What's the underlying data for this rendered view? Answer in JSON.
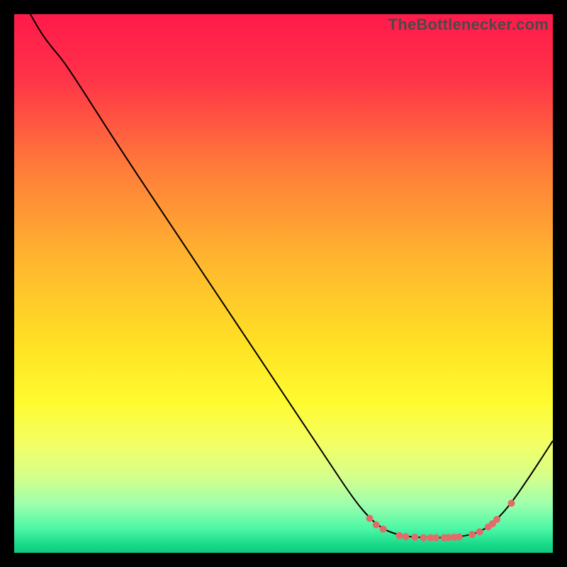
{
  "watermark": "TheBottlenecker.com",
  "chart_data": {
    "type": "line",
    "title": "",
    "xlabel": "",
    "ylabel": "",
    "xlim": [
      0,
      100
    ],
    "ylim": [
      0,
      100
    ],
    "grid": false,
    "background_gradient": {
      "stops": [
        {
          "offset": 0,
          "color": "#ff1a4b"
        },
        {
          "offset": 0.12,
          "color": "#ff3348"
        },
        {
          "offset": 0.28,
          "color": "#ff7a3a"
        },
        {
          "offset": 0.45,
          "color": "#ffb42f"
        },
        {
          "offset": 0.62,
          "color": "#ffe324"
        },
        {
          "offset": 0.72,
          "color": "#fffb30"
        },
        {
          "offset": 0.8,
          "color": "#f2ff66"
        },
        {
          "offset": 0.86,
          "color": "#d4ff8c"
        },
        {
          "offset": 0.91,
          "color": "#9dffad"
        },
        {
          "offset": 0.955,
          "color": "#4cf7a6"
        },
        {
          "offset": 0.985,
          "color": "#19d98a"
        },
        {
          "offset": 1.0,
          "color": "#10c97e"
        }
      ]
    },
    "series": [
      {
        "name": "bottleneck-curve",
        "color": "#000000",
        "stroke_width": 2,
        "points": [
          {
            "x": 3.0,
            "y": 100.0
          },
          {
            "x": 5.0,
            "y": 96.5
          },
          {
            "x": 7.0,
            "y": 93.8
          },
          {
            "x": 9.0,
            "y": 91.5
          },
          {
            "x": 12.0,
            "y": 87.0
          },
          {
            "x": 20.0,
            "y": 74.5
          },
          {
            "x": 30.0,
            "y": 59.5
          },
          {
            "x": 40.0,
            "y": 44.5
          },
          {
            "x": 50.0,
            "y": 29.5
          },
          {
            "x": 58.0,
            "y": 17.5
          },
          {
            "x": 63.0,
            "y": 10.0
          },
          {
            "x": 66.0,
            "y": 6.4
          },
          {
            "x": 68.5,
            "y": 4.4
          },
          {
            "x": 71.0,
            "y": 3.4
          },
          {
            "x": 74.0,
            "y": 2.9
          },
          {
            "x": 78.0,
            "y": 2.8
          },
          {
            "x": 82.0,
            "y": 2.9
          },
          {
            "x": 85.0,
            "y": 3.4
          },
          {
            "x": 87.0,
            "y": 4.2
          },
          {
            "x": 89.0,
            "y": 5.6
          },
          {
            "x": 92.0,
            "y": 8.8
          },
          {
            "x": 96.0,
            "y": 14.6
          },
          {
            "x": 100.0,
            "y": 20.8
          }
        ]
      }
    ],
    "markers": {
      "color": "#e46a6a",
      "radius": 5,
      "points": [
        {
          "x": 66.0,
          "y": 6.4
        },
        {
          "x": 67.2,
          "y": 5.2
        },
        {
          "x": 68.5,
          "y": 4.4
        },
        {
          "x": 71.5,
          "y": 3.2
        },
        {
          "x": 72.7,
          "y": 3.0
        },
        {
          "x": 74.4,
          "y": 2.9
        },
        {
          "x": 76.0,
          "y": 2.8
        },
        {
          "x": 77.3,
          "y": 2.8
        },
        {
          "x": 78.3,
          "y": 2.8
        },
        {
          "x": 79.8,
          "y": 2.8
        },
        {
          "x": 80.6,
          "y": 2.85
        },
        {
          "x": 81.7,
          "y": 2.9
        },
        {
          "x": 82.6,
          "y": 2.95
        },
        {
          "x": 85.0,
          "y": 3.4
        },
        {
          "x": 86.4,
          "y": 3.9
        },
        {
          "x": 88.0,
          "y": 4.8
        },
        {
          "x": 88.8,
          "y": 5.4
        },
        {
          "x": 89.6,
          "y": 6.2
        },
        {
          "x": 92.3,
          "y": 9.2
        }
      ]
    }
  }
}
